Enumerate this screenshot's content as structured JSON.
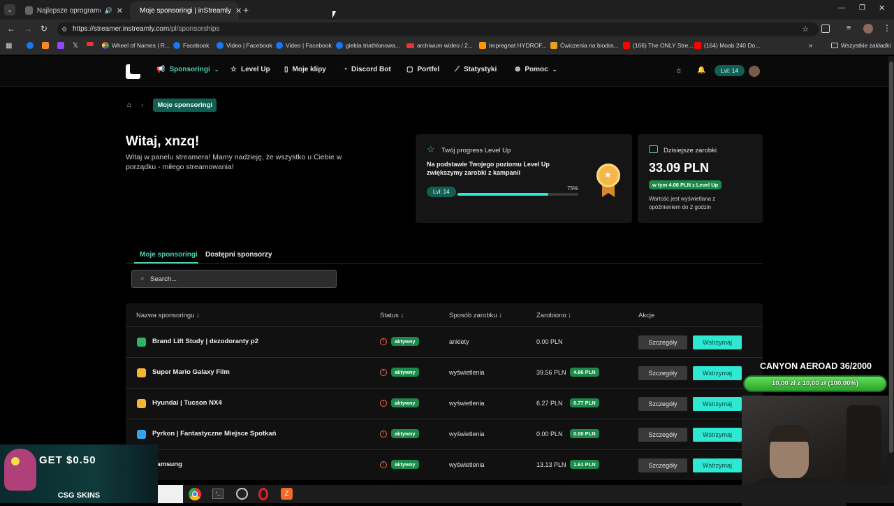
{
  "browser": {
    "tabs": [
      {
        "title": "Najlepsze oprogramowanie",
        "active": false
      },
      {
        "title": "Moje sponsoringi | inStreamly",
        "active": true
      }
    ],
    "url_host": "https://streamer.instreamly.com",
    "url_path": "/pl/sponsorships",
    "bookmarks": [
      "Wheel of Names | R...",
      "Facebook",
      "Video | Facebook",
      "Video | Facebook",
      "giełda triathlonowa...",
      "archiwum wideo / 2...",
      "Impregnat HYDROF...",
      "Ćwiczenia na biodra...",
      "(166) The ONLY Stre...",
      "(164) Moab 240 Do..."
    ],
    "all_bookmarks": "Wszystkie zakładki"
  },
  "nav": {
    "items": [
      {
        "label": "Sponsoringi",
        "icon": "megaphone-icon",
        "active": true
      },
      {
        "label": "Level Up",
        "icon": "star-icon"
      },
      {
        "label": "Moje klipy",
        "icon": "clip-icon"
      },
      {
        "label": "Discord Bot",
        "icon": "discord-icon"
      },
      {
        "label": "Portfel",
        "icon": "wallet-icon"
      },
      {
        "label": "Statystyki",
        "icon": "chart-icon"
      },
      {
        "label": "Pomoc",
        "icon": "help-icon"
      }
    ],
    "level": "Lvl: 14"
  },
  "breadcrumb": {
    "current": "Moje sponsoringi"
  },
  "welcome": {
    "title": "Witaj, xnzq!",
    "text": "Witaj w panelu streamera! Mamy nadzieję, że wszystko u Ciebie w porządku - miłego streamowania!"
  },
  "levelup_card": {
    "title": "Twój progress Level Up",
    "desc": "Na podstawie Twojego poziomu Level Up zwiększymy zarobki z kampanii",
    "level": "Lvl: 14",
    "percent_label": "75%",
    "progress": 0.75
  },
  "earnings_card": {
    "title": "Dzisiejsze zarobki",
    "amount": "33.09 PLN",
    "badge": "w tym 4.06 PLN z Level Up",
    "note": "Wartość jest wyświetlana z opóźnieniem do 2 godzin"
  },
  "tabs": [
    "Moje sponsoringi",
    "Dostępni sponsorzy"
  ],
  "search": {
    "placeholder": "Search..."
  },
  "table": {
    "headers": [
      "Nazwa sponsoringu ↓",
      "Status ↓",
      "Sposób zarobku ↓",
      "Zarobiono ↓",
      "Akcje"
    ],
    "details_label": "Szczegóły",
    "pause_label": "Wstrzymaj",
    "rows": [
      {
        "name": "Brand Lift Study | dezodoranty p2",
        "status": "aktywny",
        "way": "ankiety",
        "earned": "0.00 PLN",
        "badge": "",
        "color": "#2fb36a"
      },
      {
        "name": "Super Mario Galaxy Film",
        "status": "aktywny",
        "way": "wyświetlenia",
        "earned": "39.56 PLN",
        "badge": "4.86 PLN",
        "color": "#f2b534"
      },
      {
        "name": "Hyundai | Tucson NX4",
        "status": "aktywny",
        "way": "wyświetlenia",
        "earned": "6.27 PLN",
        "badge": "0.77 PLN",
        "color": "#f2b534"
      },
      {
        "name": "Pyrkon | Fantastyczne Miejsce Spotkań",
        "status": "aktywny",
        "way": "wyświetlenia",
        "earned": "0.00 PLN",
        "badge": "0.00 PLN",
        "color": "#3aa0e8"
      },
      {
        "name": "Samsung",
        "status": "aktywny",
        "way": "wyświetlenia",
        "earned": "13.13 PLN",
        "badge": "1.61 PLN",
        "color": "#3a6ae8"
      }
    ]
  },
  "overlay": {
    "goal_title": "CANYON AEROAD 36/2000",
    "goal_progress": "10,00 zł z 10,00 zł (100.00%)",
    "promo_get": "GET $0.50",
    "promo_brand": "CSG SKINS"
  }
}
